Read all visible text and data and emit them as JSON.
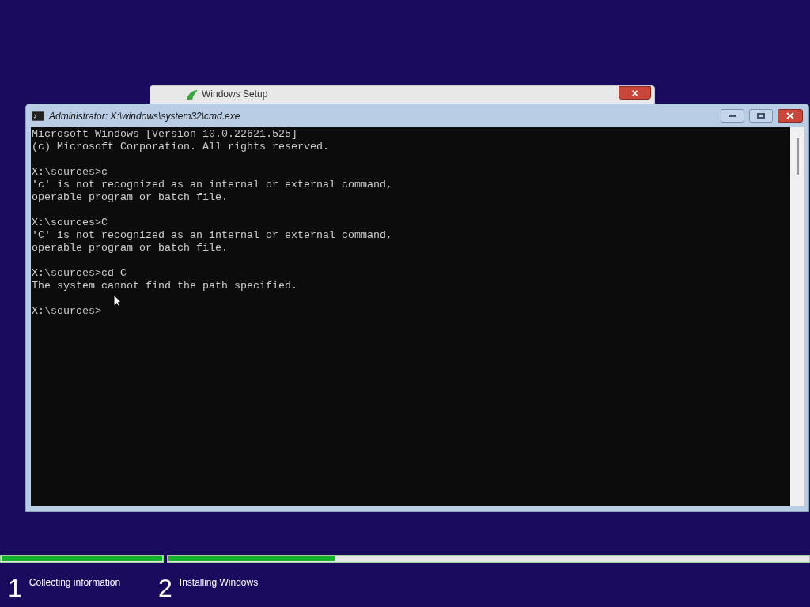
{
  "background_window": {
    "title": "Windows Setup",
    "close_label": "×"
  },
  "console_window": {
    "title": "Administrator: X:\\windows\\system32\\cmd.exe",
    "blocks": [
      [
        "Microsoft Windows [Version 10.0.22621.525]",
        "(c) Microsoft Corporation. All rights reserved."
      ],
      [
        "X:\\sources>c",
        "'c' is not recognized as an internal or external command,",
        "operable program or batch file."
      ],
      [
        "X:\\sources>C",
        "'C' is not recognized as an internal or external command,",
        "operable program or batch file."
      ],
      [
        "X:\\sources>cd C",
        "The system cannot find the path specified."
      ],
      [
        "X:\\sources>"
      ]
    ]
  },
  "steps": [
    {
      "number": "1",
      "label": "Collecting information",
      "level": 1
    },
    {
      "number": "2",
      "label": "Installing Windows",
      "level": 0.26
    }
  ]
}
